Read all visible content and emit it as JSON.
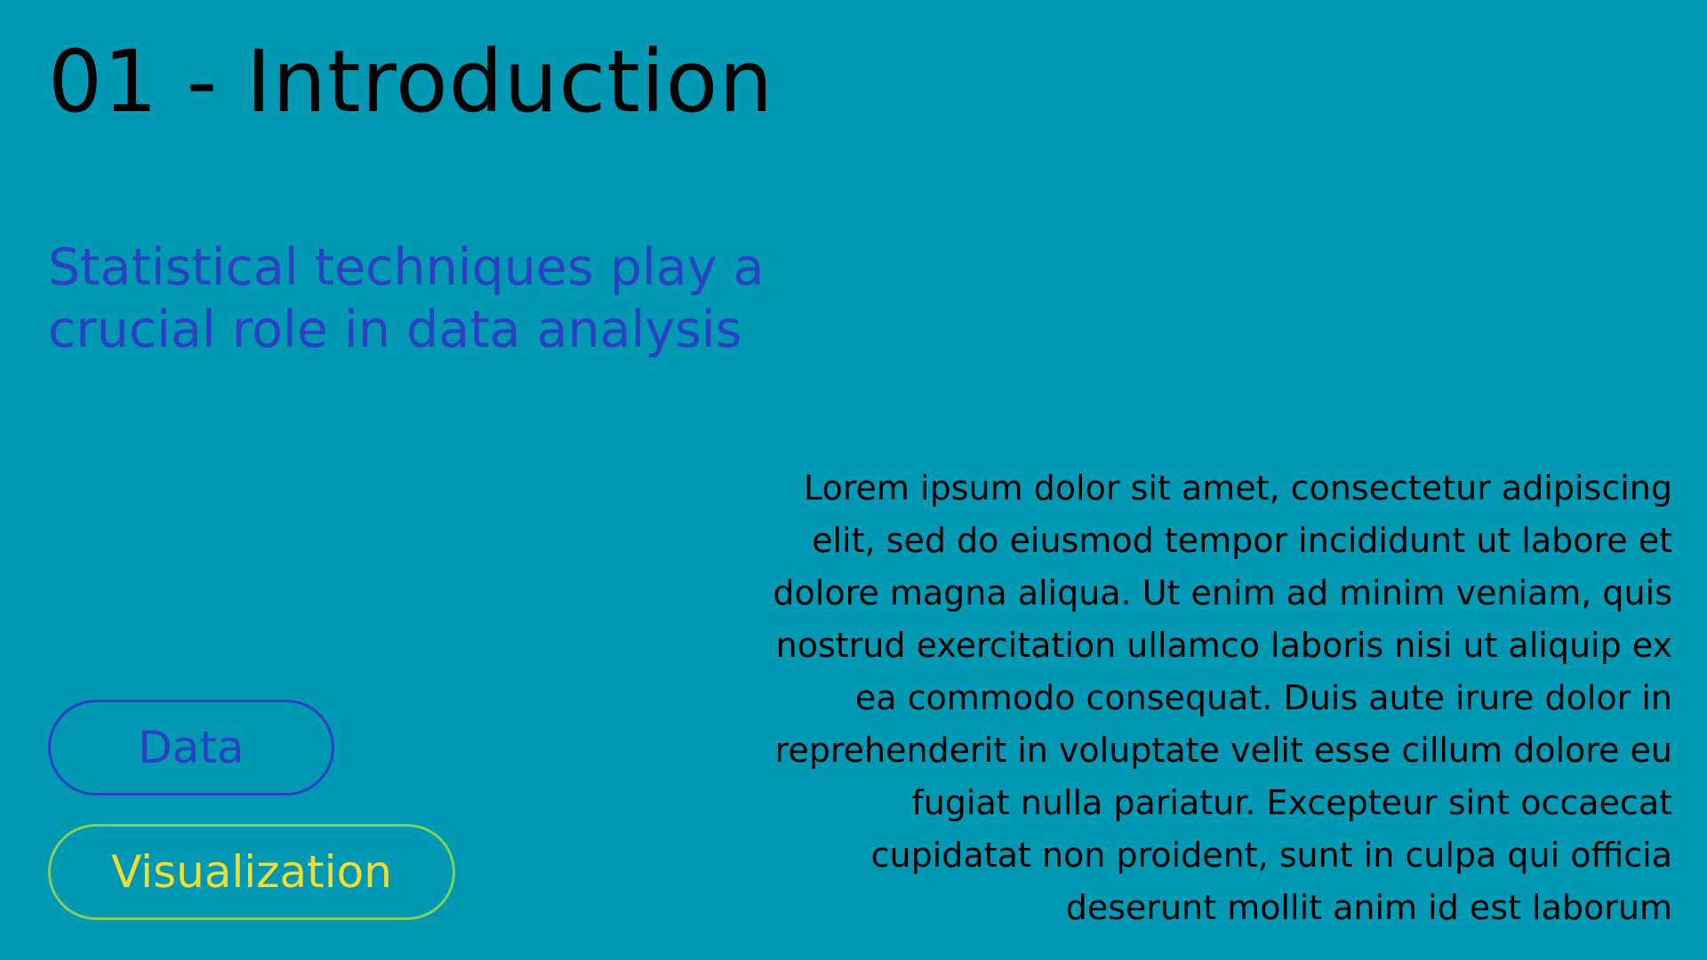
{
  "slide": {
    "title": "01 - Introduction",
    "subtitle_lines": [
      "Statistical techniques play a",
      "crucial role in data analysis"
    ],
    "body_lines": [
      "Lorem ipsum dolor sit amet, consectetur adipiscing",
      "elit, sed do eiusmod tempor incididunt ut labore et",
      "dolore magna aliqua. Ut enim ad minim veniam, quis",
      "nostrud exercitation ullamco laboris nisi ut aliquip ex",
      "ea commodo consequat. Duis aute irure dolor in",
      "reprehenderit in voluptate velit esse cillum dolore eu",
      "fugiat nulla pariatur. Excepteur sint occaecat",
      "cupidatat non proident, sunt in culpa qui officia",
      "deserunt mollit anim id est laborum"
    ],
    "tags": [
      {
        "label": "Data"
      },
      {
        "label": "Visualization"
      }
    ]
  },
  "colors": {
    "background": "#0098b3",
    "title": "#000000",
    "subtitle": "#2b41c2",
    "data_tag": "#2b41c2",
    "visualization_tag_border": "#7fd15a",
    "visualization_tag_text": "#f2dd2f"
  }
}
